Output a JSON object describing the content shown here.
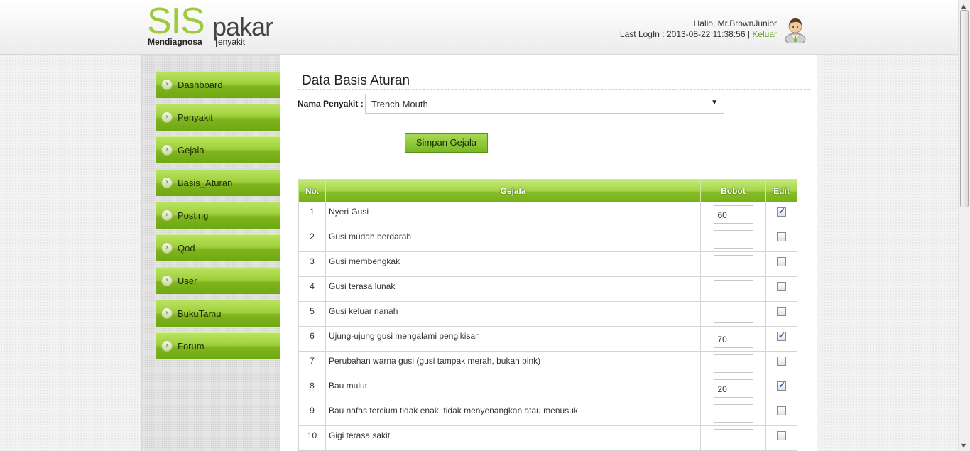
{
  "logo": {
    "sis": "SIS",
    "pakar": "pakar",
    "tagline_a": "Mendiagnosa",
    "tagline_b": "enyakit"
  },
  "header": {
    "greeting": "Hallo, Mr.BrownJunior",
    "last_login": "Last LogIn : 2013-08-22 11:38:56 |",
    "logout": "Keluar"
  },
  "sidebar": {
    "items": [
      {
        "label": "Dashboard"
      },
      {
        "label": "Penyakit"
      },
      {
        "label": "Gejala"
      },
      {
        "label": "Basis_Aturan"
      },
      {
        "label": "Posting"
      },
      {
        "label": "Qod"
      },
      {
        "label": "User"
      },
      {
        "label": "BukuTamu"
      },
      {
        "label": "Forum"
      }
    ]
  },
  "main": {
    "title": "Data Basis Aturan",
    "nama_label": "Nama Penyakit :",
    "nama_value": "Trench Mouth",
    "save_label": "Simpan Gejala",
    "columns": [
      "No.",
      "Gejala",
      "Bobot",
      "Edit"
    ],
    "rows": [
      {
        "no": "1",
        "gejala": "Nyeri Gusi",
        "bobot": "60",
        "edit": true
      },
      {
        "no": "2",
        "gejala": "Gusi mudah berdarah",
        "bobot": "",
        "edit": false
      },
      {
        "no": "3",
        "gejala": "Gusi membengkak",
        "bobot": "",
        "edit": false
      },
      {
        "no": "4",
        "gejala": "Gusi terasa lunak",
        "bobot": "",
        "edit": false
      },
      {
        "no": "5",
        "gejala": "Gusi keluar nanah",
        "bobot": "",
        "edit": false
      },
      {
        "no": "6",
        "gejala": "Ujung-ujung gusi mengalami pengikisan",
        "bobot": "70",
        "edit": true
      },
      {
        "no": "7",
        "gejala": "Perubahan warna gusi (gusi tampak merah, bukan pink)",
        "bobot": "",
        "edit": false
      },
      {
        "no": "8",
        "gejala": "Bau mulut",
        "bobot": "20",
        "edit": true
      },
      {
        "no": "9",
        "gejala": "Bau nafas tercium tidak enak, tidak menyenangkan atau menusuk",
        "bobot": "",
        "edit": false
      },
      {
        "no": "10",
        "gejala": "Gigi terasa sakit",
        "bobot": "",
        "edit": false
      }
    ]
  },
  "icons": {
    "menu_bullet": "chevron-right-icon",
    "avatar": "user-avatar-icon",
    "dropdown": "caret-down-icon"
  },
  "colors": {
    "accent_green": "#8cc43a",
    "logo_green": "#9ccc3c",
    "logout_link": "#6a9a1f"
  }
}
